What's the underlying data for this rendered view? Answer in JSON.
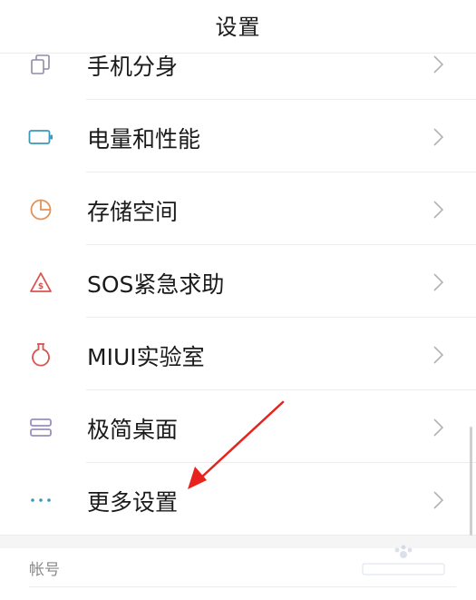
{
  "header": {
    "title": "设置"
  },
  "settings": {
    "items": [
      {
        "label": "手机分身",
        "icon": "dual-apps-icon",
        "color": "#8e8ca8"
      },
      {
        "label": "电量和性能",
        "icon": "battery-icon",
        "color": "#3b98b8"
      },
      {
        "label": "存储空间",
        "icon": "storage-pie-icon",
        "color": "#e1935a"
      },
      {
        "label": "SOS紧急求助",
        "icon": "sos-icon",
        "color": "#d9534f"
      },
      {
        "label": "MIUI实验室",
        "icon": "flask-icon",
        "color": "#d9534f"
      },
      {
        "label": "极简桌面",
        "icon": "simple-home-icon",
        "color": "#9b8fbf"
      },
      {
        "label": "更多设置",
        "icon": "more-dots-icon",
        "color": "#3b98b8"
      }
    ]
  },
  "section": {
    "title": "帐号"
  },
  "annotation": {
    "arrow_color": "#e8221c"
  }
}
